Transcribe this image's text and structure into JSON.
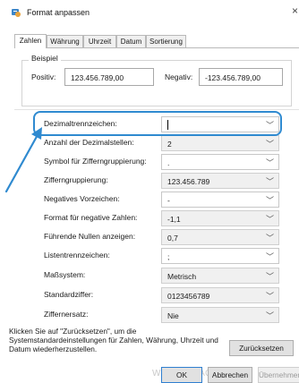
{
  "window": {
    "title": "Format anpassen"
  },
  "tabs": [
    {
      "label": "Zahlen",
      "active": true
    },
    {
      "label": "Währung",
      "active": false
    },
    {
      "label": "Uhrzeit",
      "active": false
    },
    {
      "label": "Datum",
      "active": false
    },
    {
      "label": "Sortierung",
      "active": false
    }
  ],
  "sample": {
    "group_label": "Beispiel",
    "positive_label": "Positiv:",
    "positive_value": "123.456.789,00",
    "negative_label": "Negativ:",
    "negative_value": "-123.456.789,00"
  },
  "settings": [
    {
      "label": "Dezimaltrennzeichen:",
      "value": "",
      "editable": true,
      "highlighted": true
    },
    {
      "label": "Anzahl der Dezimalstellen:",
      "value": "2",
      "editable": false
    },
    {
      "label": "Symbol für Zifferngruppierung:",
      "value": ".",
      "editable": true
    },
    {
      "label": "Zifferngruppierung:",
      "value": "123.456.789",
      "editable": false
    },
    {
      "label": "Negatives Vorzeichen:",
      "value": "-",
      "editable": true
    },
    {
      "label": "Format für negative Zahlen:",
      "value": "-1,1",
      "editable": false
    },
    {
      "label": "Führende Nullen anzeigen:",
      "value": "0,7",
      "editable": false
    },
    {
      "label": "Listentrennzeichen:",
      "value": ";",
      "editable": true
    },
    {
      "label": "Maßsystem:",
      "value": "Metrisch",
      "editable": false
    },
    {
      "label": "Standardziffer:",
      "value": "0123456789",
      "editable": false
    },
    {
      "label": "Ziffernersatz:",
      "value": "Nie",
      "editable": false
    }
  ],
  "footer": {
    "info_text": "Klicken Sie auf \"Zurücksetzen\", um die Systemstandardeinstellungen für Zahlen, Währung, Uhrzeit und Datum wiederherzustellen.",
    "reset_label": "Zurücksetzen",
    "ok_label": "OK",
    "cancel_label": "Abbrechen",
    "apply_label": "Übernehmen"
  },
  "watermark": "Windows-FAQ",
  "colors": {
    "highlight": "#2f8ad0",
    "arrow": "#2f8ad0",
    "primary_border": "#2f7fd0"
  }
}
